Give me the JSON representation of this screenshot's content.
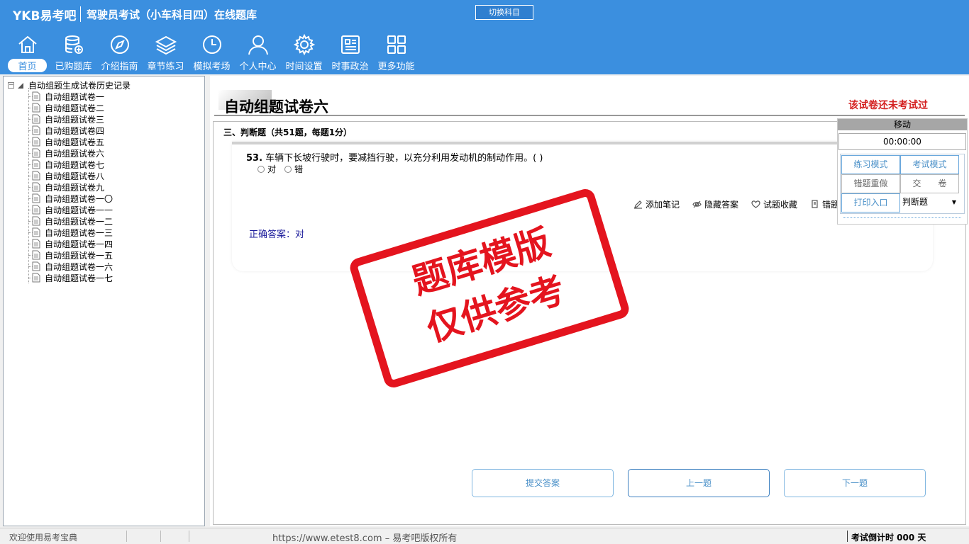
{
  "header": {
    "brand": "YKB易考吧",
    "title": "驾驶员考试（小车科目四）在线题库",
    "switch_label": "切换科目",
    "nav": [
      {
        "label": "首页",
        "icon": "home-icon"
      },
      {
        "label": "已购题库",
        "icon": "database-icon"
      },
      {
        "label": "介绍指南",
        "icon": "compass-icon"
      },
      {
        "label": "章节练习",
        "icon": "layers-icon"
      },
      {
        "label": "模拟考场",
        "icon": "clock-icon"
      },
      {
        "label": "个人中心",
        "icon": "user-icon"
      },
      {
        "label": "时间设置",
        "icon": "gear-icon"
      },
      {
        "label": "时事政治",
        "icon": "news-icon"
      },
      {
        "label": "更多功能",
        "icon": "grid-icon"
      }
    ]
  },
  "tree": {
    "root": "自动组题生成试卷历史记录",
    "items": [
      "自动组题试卷一",
      "自动组题试卷二",
      "自动组题试卷三",
      "自动组题试卷四",
      "自动组题试卷五",
      "自动组题试卷六",
      "自动组题试卷七",
      "自动组题试卷八",
      "自动组题试卷九",
      "自动组题试卷一〇",
      "自动组题试卷一一",
      "自动组题试卷一二",
      "自动组题试卷一三",
      "自动组题试卷一四",
      "自动组题试卷一五",
      "自动组题试卷一六",
      "自动组题试卷一七"
    ]
  },
  "main": {
    "paper_title": "自动组题试卷六",
    "status": "该试卷还未考试过",
    "section": "三、判断题（共51题，每题1分）",
    "question": {
      "number": "53.",
      "text": "车辆下长坡行驶时，要减挡行驶，以充分利用发动机的制动作用。( )",
      "options": [
        "对",
        "错"
      ],
      "answer": "正确答案：对"
    },
    "tools": [
      "添加笔记",
      "隐藏答案",
      "试题收藏",
      "错题"
    ],
    "buttons": {
      "submit": "提交答案",
      "prev": "上一题",
      "next": "下一题"
    }
  },
  "float_panel": {
    "move": "移动",
    "timer": "00:00:00",
    "practice": "练习模式",
    "exam": "考试模式",
    "redo": "错题重做",
    "hand_in": "交　　卷",
    "print": "打印入口",
    "type": "判断题"
  },
  "watermark": {
    "line1": "题库模版",
    "line2": "仅供参考"
  },
  "statusbar": {
    "welcome": "欢迎使用易考宝典",
    "url": "https://www.etest8.com – 易考吧版权所有",
    "countdown": "考试倒计时 000 天"
  },
  "colors": {
    "header": "#3b8fdf",
    "accent": "#d42020",
    "stamp": "#e4141e"
  }
}
